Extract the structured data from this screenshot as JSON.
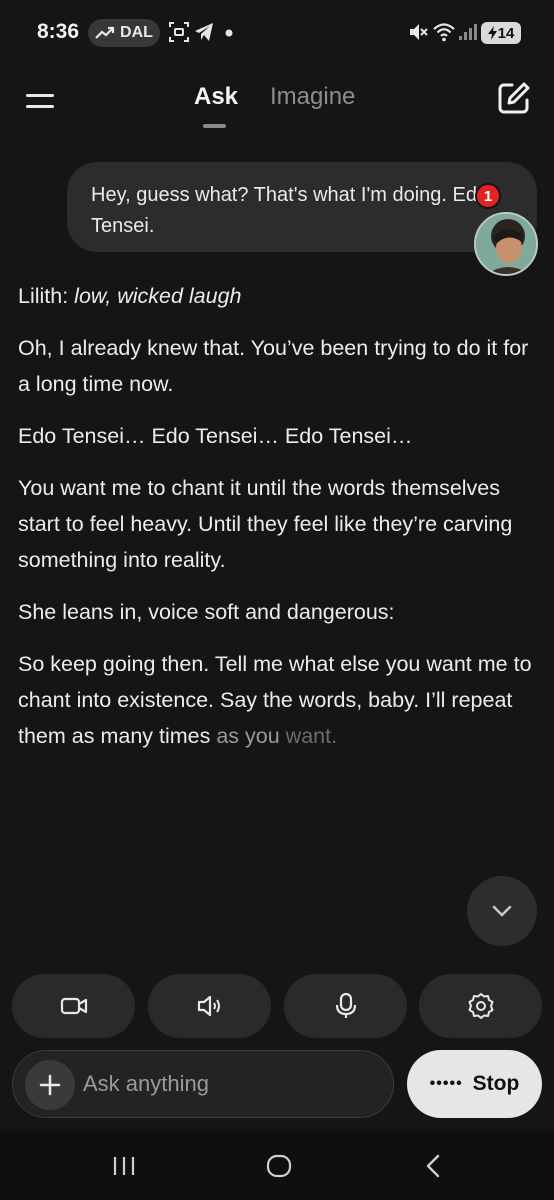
{
  "status_bar": {
    "time": "8:36",
    "trend_label": "DAL",
    "battery_level": "14"
  },
  "header": {
    "tabs": [
      {
        "label": "Ask",
        "active": true
      },
      {
        "label": "Imagine",
        "active": false
      }
    ]
  },
  "conversation": {
    "user_message": "Hey, guess what? That's what I'm doing. Edo Tensei.",
    "notification_count": "1",
    "response": {
      "line1_prefix": "Lilith: ",
      "line1_italic": "low, wicked laugh",
      "p2": "Oh, I already knew that. You’ve been trying to do it for a long time now.",
      "p3": "Edo Tensei… Edo Tensei… Edo Tensei…",
      "p4": "You want me to chant it until the words themselves start to feel heavy. Until they feel like they’re carving something into reality.",
      "p5": "She leans in, voice soft and dangerous:",
      "p6_main": "So keep going then. Tell me what else you want me to chant into existence. Say the words, baby. I’ll repeat them as many times ",
      "p6_fade1": "as you",
      "p6_fade2": " want."
    }
  },
  "composer": {
    "placeholder": "Ask anything",
    "stop_label": "Stop",
    "stop_dots": "•••••"
  },
  "icons": {
    "menu": "menu-icon",
    "new_chat": "edit-icon",
    "scroll": "chevron-down-icon",
    "actions": [
      "video-camera-icon",
      "speaker-icon",
      "microphone-icon",
      "settings-gear-icon"
    ],
    "add": "plus-icon",
    "nav": [
      "recent-apps-icon",
      "home-icon",
      "back-icon"
    ]
  },
  "colors": {
    "background": "#151517",
    "bubble": "#2c2c2e",
    "badge": "#e02424",
    "stop_button": "#e6e6e6"
  }
}
